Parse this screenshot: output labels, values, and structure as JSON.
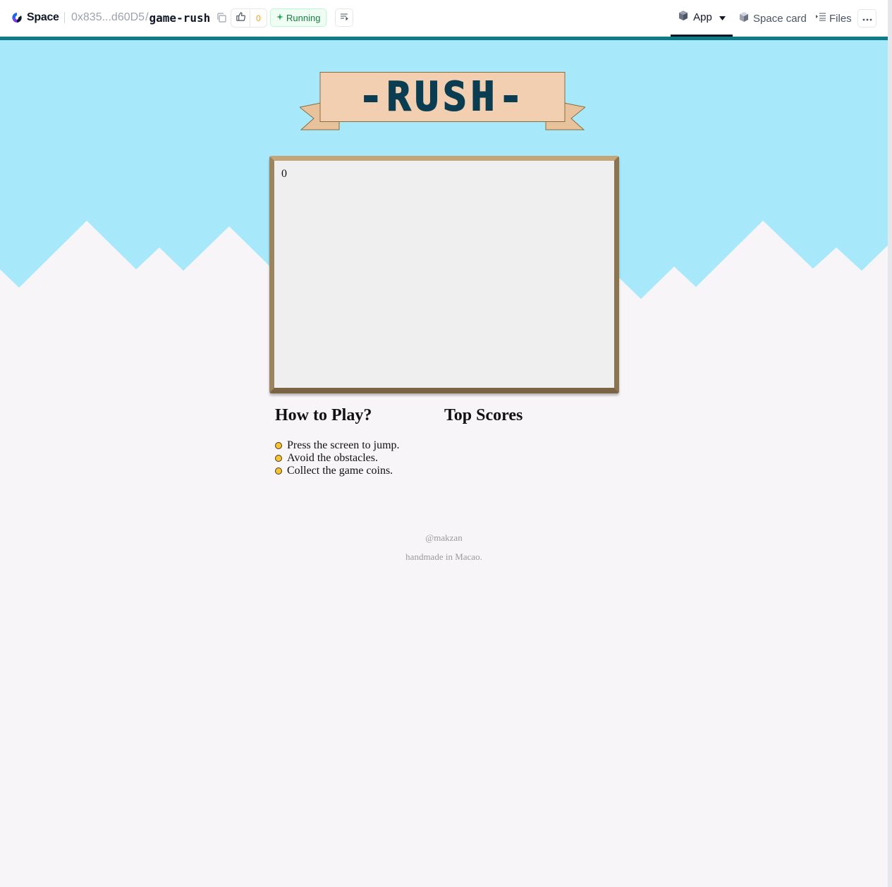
{
  "header": {
    "brand": "Space",
    "repo_owner": "0x835...d60D5",
    "repo_slash": "/",
    "repo_name": "game-rush",
    "like_count": "0",
    "status": "Running",
    "tabs": {
      "app": "App",
      "space_card": "Space card",
      "files": "Files"
    },
    "colors": {
      "accent_line": "#0e7c86",
      "status_green": "#15803d"
    }
  },
  "game": {
    "title": "-RUSH-",
    "score": "0",
    "colors": {
      "sky": "#a7e9fa",
      "banner": "#f1cfb0",
      "title": "#0a3d52",
      "frame": "#8a7352"
    }
  },
  "how_to_play": {
    "title": "How to Play?",
    "items": [
      "Press the screen to jump.",
      "Avoid the obstacles.",
      "Collect the game coins."
    ]
  },
  "top_scores": {
    "title": "Top Scores"
  },
  "credits": {
    "author": "@makzan",
    "place": "handmade in Macao."
  }
}
